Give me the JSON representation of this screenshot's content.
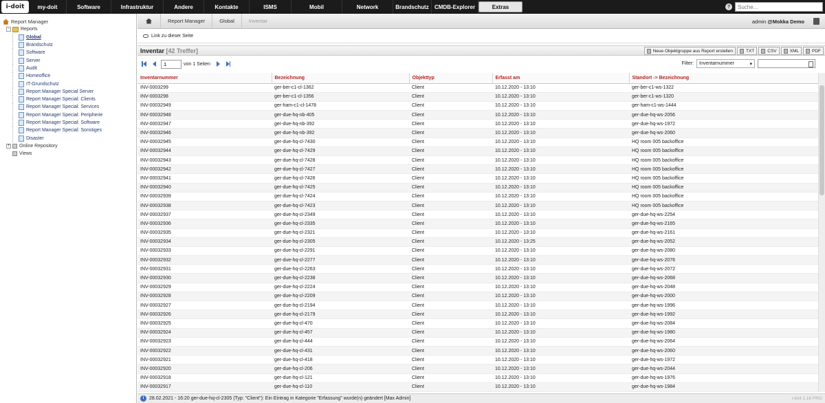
{
  "topbar": {
    "logo_text": "i-doit",
    "nav": [
      {
        "label": "my-doit",
        "width": 55
      },
      {
        "label": "Software",
        "width": 65
      },
      {
        "label": "Infrastruktur",
        "width": 76
      },
      {
        "label": "Andere",
        "width": 59
      },
      {
        "label": "Kontakte",
        "width": 66
      },
      {
        "label": "ISMS",
        "width": 61
      },
      {
        "label": "Mobil",
        "width": 74
      },
      {
        "label": "Network",
        "width": 74
      },
      {
        "label": "Brandschutz",
        "width": 56
      },
      {
        "label": "CMDB-Explorer",
        "width": 68
      },
      {
        "label": "Extras",
        "width": 64,
        "active": true
      }
    ],
    "search_placeholder": "Suche..."
  },
  "sidebar": {
    "items": [
      {
        "label": "Report Manager",
        "icon": "home-icon",
        "level": 0,
        "toggle": ""
      },
      {
        "label": "Reports",
        "icon": "folder-icon",
        "level": 1,
        "toggle": "-"
      },
      {
        "label": "Global",
        "icon": "report-icon",
        "level": 2,
        "active": true
      },
      {
        "label": "Brandschutz",
        "icon": "report-icon",
        "level": 2
      },
      {
        "label": "Software",
        "icon": "report-icon",
        "level": 2
      },
      {
        "label": "Server",
        "icon": "report-icon",
        "level": 2
      },
      {
        "label": "Audit",
        "icon": "report-icon",
        "level": 2
      },
      {
        "label": "Homeoffice",
        "icon": "report-icon",
        "level": 2
      },
      {
        "label": "IT-Grundschutz",
        "icon": "report-icon",
        "level": 2
      },
      {
        "label": "Report Manager Special Server",
        "icon": "report-icon",
        "level": 2
      },
      {
        "label": "Report Manager Special: Clients",
        "icon": "report-icon",
        "level": 2
      },
      {
        "label": "Report Manager Special: Services",
        "icon": "report-icon",
        "level": 2
      },
      {
        "label": "Report Manager Special: Peripherie",
        "icon": "report-icon",
        "level": 2
      },
      {
        "label": "Report Manager Special: Software",
        "icon": "report-icon",
        "level": 2
      },
      {
        "label": "Report Manager Special: Sonstiges",
        "icon": "report-icon",
        "level": 2
      },
      {
        "label": "Disaster",
        "icon": "report-icon",
        "level": 2
      },
      {
        "label": "Online Repository",
        "icon": "repository-icon",
        "level": 1,
        "toggle": "+"
      },
      {
        "label": "Views",
        "icon": "views-icon",
        "level": 1,
        "toggle": ""
      }
    ]
  },
  "breadcrumb": {
    "items": [
      "Report Manager",
      "Global",
      "Inventar"
    ],
    "user": "admin",
    "tenant": "@Mokka Demo"
  },
  "link_label": "Link zu dieser Seite",
  "report": {
    "title": "Inventar",
    "count": "[42 Treffer]",
    "buttons": {
      "new_group": "Neue Objektgruppe aus Report erstellen",
      "txt": "TXT",
      "csv": "CSV",
      "xml": "XML",
      "pdf": "PDF"
    }
  },
  "pager": {
    "page": "1",
    "of_pages": "von 1 Seiten",
    "filter_label": "Filter:",
    "filter_field": "Inventarnummer"
  },
  "table": {
    "columns": [
      "Inventarnummer",
      "Bezeichnung",
      "Objekttyp",
      "Erfasst am",
      "Standort -> Bezeichnung"
    ],
    "rows": [
      [
        "INV-0003299",
        "ger-ber-c1-cl-1362",
        "Client",
        "10.12.2020 - 13:10",
        "ger-ber-c1-ws-1322"
      ],
      [
        "INV-0003298",
        "ger-ber-c1-cl-1356",
        "Client",
        "10.12.2020 - 13:10",
        "ger-ber-c1-ws-1320"
      ],
      [
        "INV-00032949",
        "ger-ham-c1-cl-1478",
        "Client",
        "10.12.2020 - 13:10",
        "ger-ham-c1-ws-1444"
      ],
      [
        "INV-00032948",
        "ger-due-hq-nb-405",
        "Client",
        "10.12.2020 - 13:10",
        "ger-due-hq-ws-2056"
      ],
      [
        "INV-00032947",
        "ger-due-hq-nb-392",
        "Client",
        "10.12.2020 - 13:10",
        "ger-due-hq-ws-1972"
      ],
      [
        "INV-00032946",
        "ger-due-hq-nb-392",
        "Client",
        "10.12.2020 - 13:10",
        "ger-due-hq-ws-2060"
      ],
      [
        "INV-00032945",
        "ger-due-hq-cl-7430",
        "Client",
        "10.12.2020 - 13:10",
        "HQ room 005 backoffice"
      ],
      [
        "INV-00032944",
        "ger-due-hq-cl-7429",
        "Client",
        "10.12.2020 - 13:10",
        "HQ room 005 backoffice"
      ],
      [
        "INV-00032943",
        "ger-due-hq-cl-7428",
        "Client",
        "10.12.2020 - 13:10",
        "HQ room 005 backoffice"
      ],
      [
        "INV-00032942",
        "ger-due-hq-cl-7427",
        "Client",
        "10.12.2020 - 13:10",
        "HQ room 005 backoffice"
      ],
      [
        "INV-00032941",
        "ger-due-hq-cl-7426",
        "Client",
        "10.12.2020 - 13:10",
        "HQ room 005 backoffice"
      ],
      [
        "INV-00032940",
        "ger-due-hq-cl-7425",
        "Client",
        "10.12.2020 - 13:10",
        "HQ room 005 backoffice"
      ],
      [
        "INV-00032939",
        "ger-due-hq-cl-7424",
        "Client",
        "10.12.2020 - 13:10",
        "HQ room 005 backoffice"
      ],
      [
        "INV-00032938",
        "ger-due-hq-cl-7423",
        "Client",
        "10.12.2020 - 13:10",
        "HQ room 005 backoffice"
      ],
      [
        "INV-00032937",
        "ger-due-hq-cl-2349",
        "Client",
        "10.12.2020 - 13:10",
        "ger-due-hq-ws-2254"
      ],
      [
        "INV-00032936",
        "ger-due-hq-cl-2335",
        "Client",
        "10.12.2020 - 13:10",
        "ger-due-hq-ws-2165"
      ],
      [
        "INV-00032935",
        "ger-due-hq-cl-2321",
        "Client",
        "10.12.2020 - 13:10",
        "ger-due-hq-ws-2161"
      ],
      [
        "INV-00032934",
        "ger-due-hq-cl-2305",
        "Client",
        "10.12.2020 - 13:25",
        "ger-due-hq-ws-2052"
      ],
      [
        "INV-00032933",
        "ger-due-hq-cl-2291",
        "Client",
        "10.12.2020 - 13:10",
        "ger-due-hq-ws-2080"
      ],
      [
        "INV-00032932",
        "ger-due-hq-cl-2277",
        "Client",
        "10.12.2020 - 13:10",
        "ger-due-hq-ws-2076"
      ],
      [
        "INV-00032931",
        "ger-due-hq-cl-2263",
        "Client",
        "10.12.2020 - 13:10",
        "ger-due-hq-ws-2072"
      ],
      [
        "INV-00032930",
        "ger-due-hq-cl-2238",
        "Client",
        "10.12.2020 - 13:10",
        "ger-due-hq-ws-2068"
      ],
      [
        "INV-00032929",
        "ger-due-hq-cl-2224",
        "Client",
        "10.12.2020 - 13:10",
        "ger-due-hq-ws-2048"
      ],
      [
        "INV-00032928",
        "ger-due-hq-cl-2209",
        "Client",
        "10.12.2020 - 13:10",
        "ger-due-hq-ws-2000"
      ],
      [
        "INV-00032927",
        "ger-due-hq-cl-2194",
        "Client",
        "10.12.2020 - 13:10",
        "ger-due-hq-ws-1996"
      ],
      [
        "INV-00032926",
        "ger-due-hq-cl-2179",
        "Client",
        "10.12.2020 - 13:10",
        "ger-due-hq-ws-1992"
      ],
      [
        "INV-00032925",
        "ger-due-hq-cl-470",
        "Client",
        "10.12.2020 - 13:10",
        "ger-due-hq-ws-2084"
      ],
      [
        "INV-00032924",
        "ger-due-hq-cl-457",
        "Client",
        "10.12.2020 - 13:10",
        "ger-due-hq-ws-1980"
      ],
      [
        "INV-00032923",
        "ger-due-hq-cl-444",
        "Client",
        "10.12.2020 - 13:10",
        "ger-due-hq-ws-2064"
      ],
      [
        "INV-00032922",
        "ger-due-hq-cl-431",
        "Client",
        "10.12.2020 - 13:10",
        "ger-due-hq-ws-2060"
      ],
      [
        "INV-00032921",
        "ger-due-hq-cl-418",
        "Client",
        "10.12.2020 - 13:10",
        "ger-due-hq-ws-1972"
      ],
      [
        "INV-00032920",
        "ger-due-hq-cl-206",
        "Client",
        "10.12.2020 - 13:10",
        "ger-due-hq-ws-2044"
      ],
      [
        "INV-00032918",
        "ger-due-hq-cl-121",
        "Client",
        "10.12.2020 - 13:10",
        "ger-due-hq-ws-1976"
      ],
      [
        "INV-00032917",
        "ger-due-hq-cl-110",
        "Client",
        "10.12.2020 - 13:10",
        "ger-due-hq-ws-1984"
      ]
    ]
  },
  "status": {
    "message": "28.02.2021 - 16:20 ger-due-hq-cl-2305 (Typ: \"Client\"): Ein Eintrag in Kategorie \"Erfassung\" wurde(n) geändert [Max Admin]",
    "version": "i-doit 1.16 PRO"
  }
}
